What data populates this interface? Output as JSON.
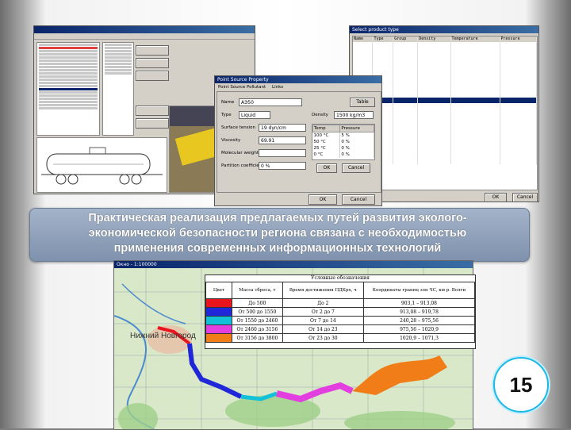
{
  "banner": {
    "text_line1": "Практическая реализация предлагаемых путей развития эколого-",
    "text_line2": "экономической безопасности региона связана с необходимостью",
    "text_line3": "применения современных информационных технологий"
  },
  "page_number": "15",
  "dialog": {
    "title": "Point Source Property",
    "tabs": [
      "Point Source",
      "Pollutant",
      "Links"
    ],
    "name_label": "Name",
    "name_value": "AЭ50",
    "button_label": "Table",
    "type_label": "Type",
    "type_value": "Liquid",
    "density_label": "Density",
    "density_value": "1500 kg/m3",
    "surface_tension_label": "Surface tension",
    "surface_tension_value": "19 dyn/cm",
    "viscosity_label": "Viscosity",
    "viscosity_value": "69.91",
    "molecular_weight_label": "Molecular weight",
    "molecular_weight_value": "",
    "coefficient_label": "Partition coefficient",
    "coefficient_value": "0 %",
    "temp_table": {
      "headers": [
        "Temp",
        "Pressure"
      ],
      "rows": [
        [
          "100 °C",
          "5 %"
        ],
        [
          "50 °C",
          "0 %"
        ],
        [
          "25 °C",
          "0 %"
        ],
        [
          "0 °C",
          "0 %"
        ]
      ]
    },
    "ok_label": "OK",
    "cancel_label": "Cancel",
    "main_ok": "OK",
    "main_cancel": "Cancel"
  },
  "table_window": {
    "title": "Select product type",
    "headers": [
      "Name",
      "Type",
      "Group",
      "Density",
      "Temperature",
      "Pressure"
    ],
    "ok_label": "OK",
    "cancel_label": "Cancel"
  },
  "legend": {
    "title": "Условные обозначения",
    "headers": [
      "Цвет",
      "Масса сброса, т",
      "Время достижения ПДКрх, ч",
      "Координаты границ зон ЧС, км р. Волги"
    ],
    "rows": [
      {
        "color": "#e8141e",
        "mass": "До 500",
        "time": "До 2",
        "coords": "903,1 – 913,08"
      },
      {
        "color": "#2027d8",
        "mass": "От 500 до 1550",
        "time": "От 2 до 7",
        "coords": "913,08 – 919,78"
      },
      {
        "color": "#12c0d8",
        "mass": "От 1550 до 2460",
        "time": "От 7 до 14",
        "coords": "240,28 – 975,56"
      },
      {
        "color": "#e23ee0",
        "mass": "От 2460 до 3156",
        "time": "От 14 до 23",
        "coords": "975,56 – 1020,9"
      },
      {
        "color": "#f07d18",
        "mass": "От 3156 до 3800",
        "time": "От 23 до 30",
        "coords": "1020,9 – 1071,3"
      }
    ]
  },
  "map": {
    "city_label": "Нижний Новгород",
    "title": "Окно - 1:100000"
  }
}
